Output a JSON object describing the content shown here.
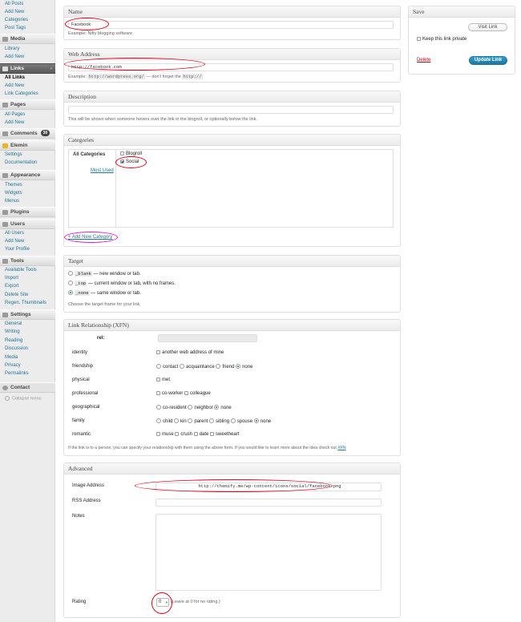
{
  "sidebar": {
    "posts_items": [
      "All Posts",
      "Add New",
      "Categories",
      "Post Tags"
    ],
    "media": {
      "label": "Media",
      "items": [
        "Library",
        "Add New"
      ]
    },
    "links": {
      "label": "Links",
      "items": [
        "All Links",
        "Add New",
        "Link Categories"
      ]
    },
    "pages": {
      "label": "Pages",
      "items": [
        "All Pages",
        "Add New"
      ]
    },
    "comments": {
      "label": "Comments",
      "count": "30"
    },
    "elemin": {
      "label": "Elemin",
      "items": [
        "Settings",
        "Documentation"
      ]
    },
    "appearance": {
      "label": "Appearance",
      "items": [
        "Themes",
        "Widgets",
        "Menus"
      ]
    },
    "plugins": {
      "label": "Plugins"
    },
    "users": {
      "label": "Users",
      "items": [
        "All Users",
        "Add New",
        "Your Profile"
      ]
    },
    "tools": {
      "label": "Tools",
      "items": [
        "Available Tools",
        "Import",
        "Export",
        "Delete Site",
        "Regen. Thumbnails"
      ]
    },
    "settings": {
      "label": "Settings",
      "items": [
        "General",
        "Writing",
        "Reading",
        "Discussion",
        "Media",
        "Privacy",
        "Permalinks"
      ]
    },
    "contact": {
      "label": "Contact"
    },
    "collapse": "Collapse menu"
  },
  "name_box": {
    "title": "Name",
    "value": "Facebook",
    "example": "Example: Nifty blogging software"
  },
  "web_box": {
    "title": "Web Address",
    "value": "http://facebook.com",
    "example_pre": "Example:",
    "example_code1": "http://wordpress.org/",
    "example_mid": "— don't forget the",
    "example_code2": "http://"
  },
  "desc_box": {
    "title": "Description",
    "value": "",
    "hint": "This will be shown when someone hovers over the link in the blogroll, or optionally below the link."
  },
  "cat_box": {
    "title": "Categories",
    "tab_all": "All Categories",
    "tab_used": "Most Used",
    "items": [
      {
        "label": "Blogroll",
        "checked": false
      },
      {
        "label": "Social",
        "checked": true
      }
    ],
    "add_new": "+ Add New Category"
  },
  "target_box": {
    "title": "Target",
    "options": [
      {
        "code": "_blank",
        "desc": "— new window or tab.",
        "checked": false
      },
      {
        "code": "_top",
        "desc": "— current window or tab, with no frames.",
        "checked": false
      },
      {
        "code": "_none",
        "desc": "— same window or tab.",
        "checked": true
      }
    ],
    "hint": "Choose the target frame for your link."
  },
  "xfn_box": {
    "title": "Link Relationship (XFN)",
    "rel_label": "rel:",
    "rows": {
      "identity": {
        "label": "identity",
        "opts": [
          {
            "t": "another web address of mine",
            "on": false
          }
        ]
      },
      "friendship": {
        "label": "friendship",
        "opts": [
          {
            "t": "contact",
            "on": false
          },
          {
            "t": "acquaintance",
            "on": false
          },
          {
            "t": "friend",
            "on": false
          },
          {
            "t": "none",
            "on": true
          }
        ]
      },
      "physical": {
        "label": "physical",
        "opts": [
          {
            "t": "met",
            "on": false
          }
        ]
      },
      "professional": {
        "label": "professional",
        "opts": [
          {
            "t": "co-worker",
            "on": false
          },
          {
            "t": "colleague",
            "on": false
          }
        ]
      },
      "geographical": {
        "label": "geographical",
        "opts": [
          {
            "t": "co-resident",
            "on": false
          },
          {
            "t": "neighbor",
            "on": false
          },
          {
            "t": "none",
            "on": true
          }
        ]
      },
      "family": {
        "label": "family",
        "opts": [
          {
            "t": "child",
            "on": false
          },
          {
            "t": "kin",
            "on": false
          },
          {
            "t": "parent",
            "on": false
          },
          {
            "t": "sibling",
            "on": false
          },
          {
            "t": "spouse",
            "on": false
          },
          {
            "t": "none",
            "on": true
          }
        ]
      },
      "romantic": {
        "label": "romantic",
        "opts": [
          {
            "t": "muse",
            "on": false
          },
          {
            "t": "crush",
            "on": false
          },
          {
            "t": "date",
            "on": false
          },
          {
            "t": "sweetheart",
            "on": false
          }
        ]
      }
    },
    "hint": "If the link is to a person, you can specify your relationship with them using the above form. If you would like to learn more about the idea check out",
    "hint_link": "XFN"
  },
  "adv_box": {
    "title": "Advanced",
    "image_label": "Image Address",
    "image_value": "http://themify.me/wp-content/icons/social/facebook.png",
    "rss_label": "RSS Address",
    "notes_label": "Notes",
    "rating_label": "Rating",
    "rating_value": "0",
    "rating_hint": "(Leave at 0 for no rating.)"
  },
  "save_box": {
    "title": "Save",
    "visit": "Visit Link",
    "private": "Keep this link private",
    "delete": "Delete",
    "update": "Update Link"
  }
}
